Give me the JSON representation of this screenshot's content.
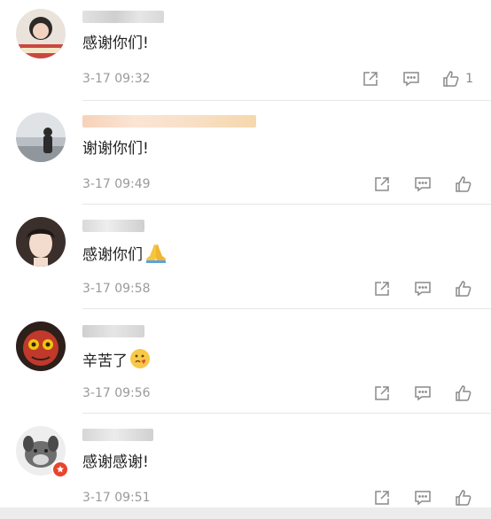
{
  "comments": [
    {
      "text": "感谢你们!",
      "time": "3-17 09:32",
      "like_count": "1",
      "emoji": ""
    },
    {
      "text": "谢谢你们!",
      "time": "3-17 09:49",
      "like_count": "",
      "emoji": ""
    },
    {
      "text": "感谢你们",
      "time": "3-17 09:58",
      "like_count": "",
      "emoji": "folded-hands-emoji"
    },
    {
      "text": "辛苦了",
      "time": "3-17 09:56",
      "like_count": "",
      "emoji": "heart-face-emoji"
    },
    {
      "text": "感谢感谢!",
      "time": "3-17 09:51",
      "like_count": "",
      "emoji": ""
    }
  ],
  "icons": {
    "share": "share-icon",
    "reply": "reply-icon",
    "like": "thumbs-up-icon"
  },
  "colors": {
    "text": "#222222",
    "meta": "#9a9a9a",
    "icon": "#8a8a8a",
    "divider": "#e6e6e6"
  }
}
